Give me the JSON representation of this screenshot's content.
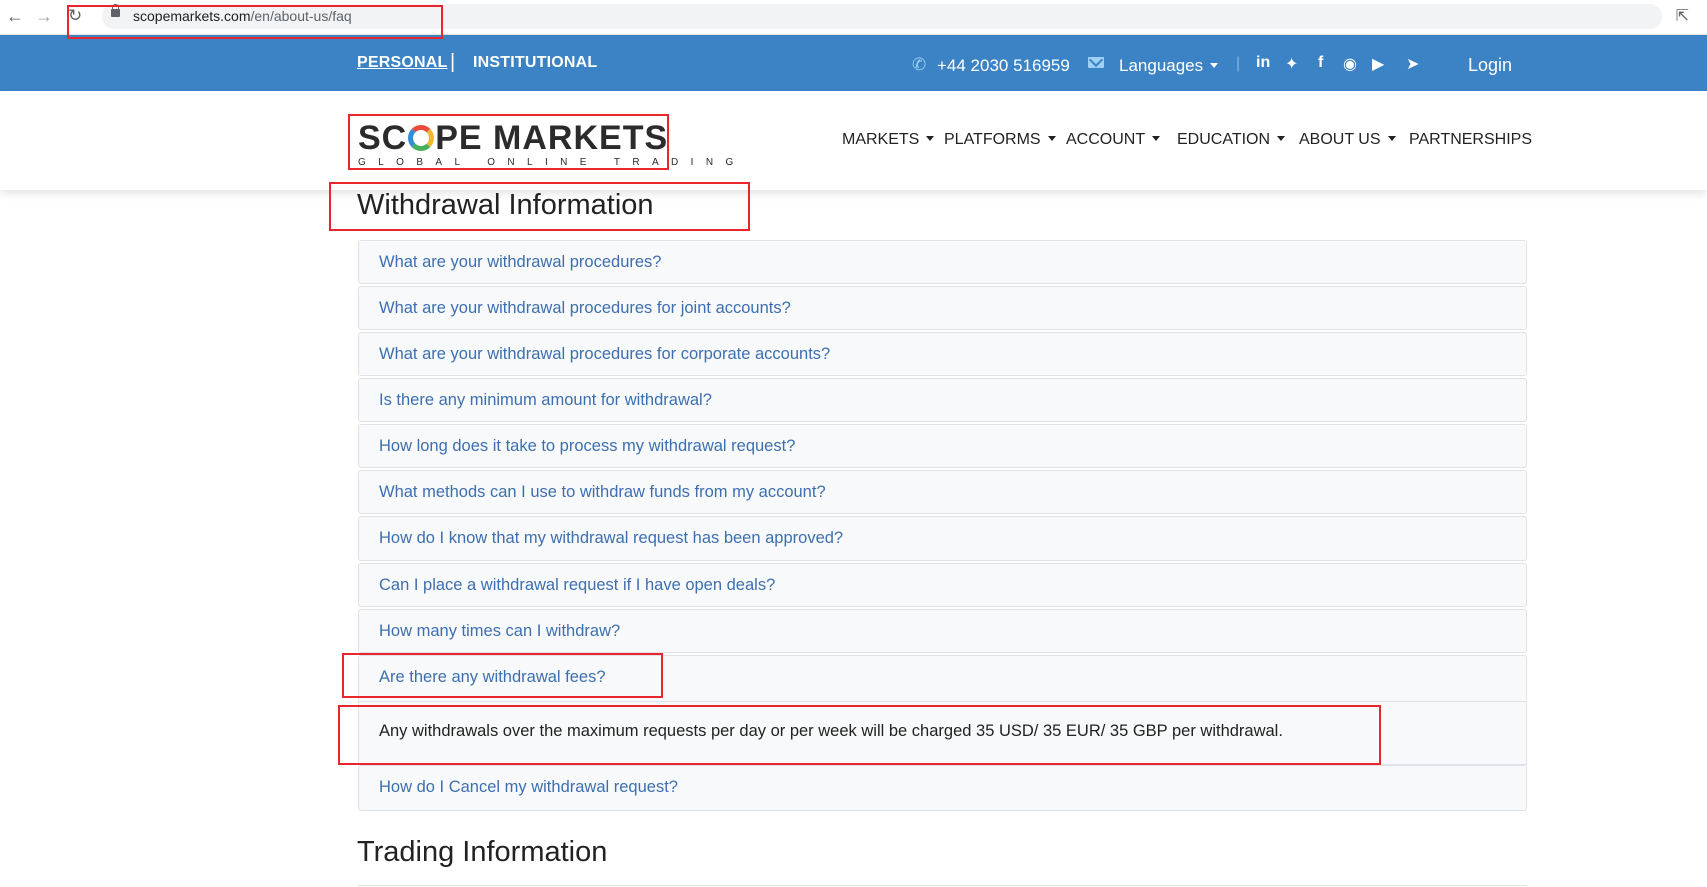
{
  "browser": {
    "url_domain": "scopemarkets.com",
    "url_path": "/en/about-us/faq"
  },
  "topbar": {
    "personal": "PERSONAL",
    "separator": "|",
    "institutional": "INSTITUTIONAL",
    "phone": "+44 2030 516959",
    "languages": "Languages",
    "divider": "|",
    "login": "Login"
  },
  "logo": {
    "line1_a": "SC",
    "line1_b": "PE MARKETS",
    "line2": "GLOBAL ONLINE TRADING"
  },
  "nav": [
    "MARKETS",
    "PLATFORMS",
    "ACCOUNT",
    "EDUCATION",
    "ABOUT US",
    "PARTNERSHIPS"
  ],
  "sections": {
    "withdrawal_title": "Withdrawal Information",
    "trading_title": "Trading Information"
  },
  "faq": [
    "What are your withdrawal procedures?",
    "What are your withdrawal procedures for joint accounts?",
    "What are your withdrawal procedures for corporate accounts?",
    "Is there any minimum amount for withdrawal?",
    "How long does it take to process my withdrawal request?",
    "What methods can I use to withdraw funds from my account?",
    "How do I know that my withdrawal request has been approved?",
    "Can I place a withdrawal request if I have open deals?",
    "How many times can I withdraw?",
    "Are there any withdrawal fees?",
    "How do I Cancel my withdrawal request?"
  ],
  "answer": "Any withdrawals over the maximum requests per day or per week will be charged 35 USD/ 35 EUR/ 35 GBP per withdrawal.",
  "icons": {
    "back": "arrow-left-icon",
    "forward": "arrow-right-icon",
    "reload": "reload-icon",
    "lock": "lock-icon",
    "share": "share-icon",
    "phone": "phone-icon",
    "mail": "mail-icon",
    "social": [
      "linkedin-icon",
      "twitter-icon",
      "facebook-icon",
      "instagram-icon",
      "youtube-icon",
      "telegram-icon"
    ]
  },
  "colors": {
    "topbar": "#3b83c4",
    "link": "#3d6fb0",
    "annotation": "#e8262b"
  }
}
